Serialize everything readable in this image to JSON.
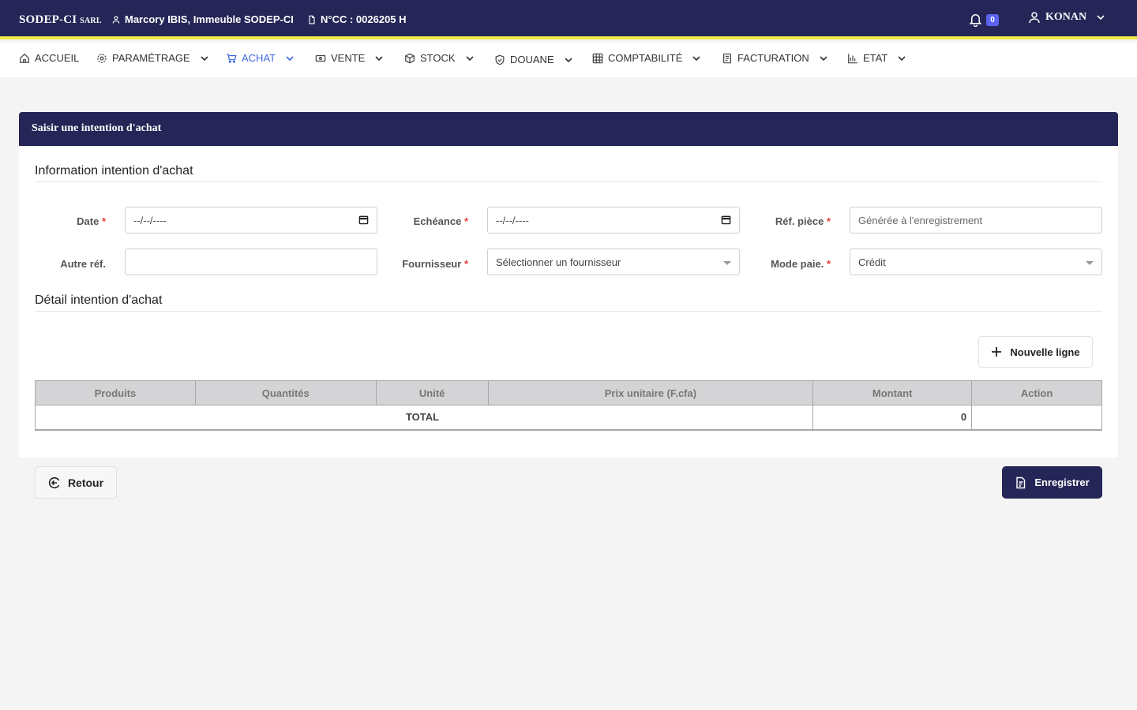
{
  "topbar": {
    "brand_main": "SODEP-CI",
    "brand_suffix": "SARL",
    "address": "Marcory IBIS, Immeuble SODEP-CI",
    "ncc": "N°CC : 0026205 H",
    "notifications_count": "0",
    "username": "KONAN"
  },
  "menu": {
    "items": [
      {
        "label": "ACCUEIL",
        "icon": "home-icon"
      },
      {
        "label": "PARAMÉTRAGE",
        "icon": "gear-icon"
      },
      {
        "label": "ACHAT",
        "icon": "cart-icon",
        "active": true
      },
      {
        "label": "VENTE",
        "icon": "cash-icon"
      },
      {
        "label": "STOCK",
        "icon": "box-icon"
      },
      {
        "label": "DOUANE",
        "icon": "shield-icon"
      },
      {
        "label": "COMPTABILITÉ",
        "icon": "grid-icon"
      },
      {
        "label": "FACTURATION",
        "icon": "invoice-icon"
      },
      {
        "label": "ETAT",
        "icon": "chart-icon"
      }
    ],
    "active_color": "#3d67e0"
  },
  "card": {
    "title": "Saisir une intention d'achat",
    "section_info": "Information intention d'achat",
    "section_detail": "Détail intention d'achat"
  },
  "form": {
    "date": {
      "label": "Date",
      "value": "--/--/----"
    },
    "echeance": {
      "label": "Echéance",
      "value": "--/--/----"
    },
    "ref_piece": {
      "label": "Réf. pièce",
      "placeholder": "Générée à l'enregistrement"
    },
    "autre_ref": {
      "label": "Autre réf.",
      "value": ""
    },
    "fournisseur": {
      "label": "Fournisseur",
      "value": "Sélectionner un fournisseur"
    },
    "mode_paie": {
      "label": "Mode paie.",
      "value": "Crédit"
    },
    "required_mark": "*"
  },
  "detail": {
    "new_line_label": "Nouvelle ligne",
    "columns": [
      "Produits",
      "Quantités",
      "Unité",
      "Prix unitaire (F.cfa)",
      "Montant",
      "Action"
    ],
    "total_label": "TOTAL",
    "total_amount": "0"
  },
  "footer": {
    "back_label": "Retour",
    "save_label": "Enregistrer"
  },
  "colors": {
    "primary": "#252657",
    "accent_stripe": "#f1e94a",
    "badge": "#5b63f0",
    "required": "#e53935"
  }
}
